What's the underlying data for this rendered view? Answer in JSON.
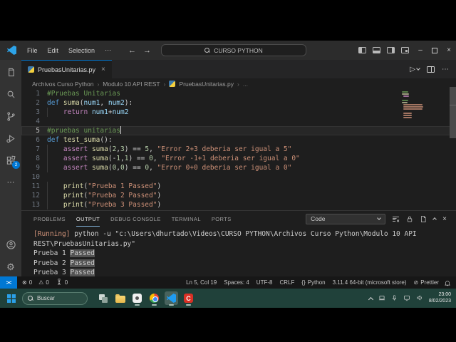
{
  "colors": {
    "accent": "#0078d4",
    "editor_bg": "#1e1e1e",
    "taskbar_bg": "#20413a",
    "remote_bg": "#0078d4"
  },
  "glyphs": {
    "close": "×",
    "more": "⋯",
    "separator": "›",
    "back": "←",
    "forward": "→",
    "min": "–",
    "run": "▷",
    "error": "⊗",
    "warning": "⚠",
    "braces": "{}",
    "slash": "⊘",
    "remote": "><",
    "gear": "⚙"
  },
  "title_bar": {
    "menus": [
      "File",
      "Edit",
      "Selection",
      "⋯"
    ],
    "search_label": "CURSO PYTHON"
  },
  "activity_bar": {
    "extensions_badge": "2"
  },
  "editor_tabs": {
    "active_tab": {
      "label": "PruebasUnitarias.py"
    }
  },
  "breadcrumb": {
    "items": [
      "Archivos Curso Python",
      "Modulo 10 API REST",
      "PruebasUnitarias.py",
      "..."
    ]
  },
  "editor": {
    "lines": [
      {
        "n": "1",
        "tokens": [
          {
            "t": "#Pruebas Unitarias",
            "c": "cm"
          }
        ]
      },
      {
        "n": "2",
        "tokens": [
          {
            "t": "def ",
            "c": "kw"
          },
          {
            "t": "suma",
            "c": "fn"
          },
          {
            "t": "(",
            "c": "pn"
          },
          {
            "t": "num1",
            "c": "var"
          },
          {
            "t": ", ",
            "c": "pn"
          },
          {
            "t": "num2",
            "c": "var"
          },
          {
            "t": "):",
            "c": "pn"
          }
        ]
      },
      {
        "n": "3",
        "ind": true,
        "tokens": [
          {
            "t": "    ",
            "c": "pn"
          },
          {
            "t": "return ",
            "c": "ctl"
          },
          {
            "t": "num1",
            "c": "var"
          },
          {
            "t": "+",
            "c": "pn"
          },
          {
            "t": "num2",
            "c": "var"
          }
        ]
      },
      {
        "n": "4",
        "tokens": []
      },
      {
        "n": "5",
        "cur": true,
        "cursor": true,
        "tokens": [
          {
            "t": "#pruebas unitarias",
            "c": "cm"
          }
        ]
      },
      {
        "n": "6",
        "tokens": [
          {
            "t": "def ",
            "c": "kw"
          },
          {
            "t": "test_suma",
            "c": "fn"
          },
          {
            "t": "():",
            "c": "pn"
          }
        ]
      },
      {
        "n": "7",
        "ind": true,
        "tokens": [
          {
            "t": "    ",
            "c": "pn"
          },
          {
            "t": "assert ",
            "c": "ctl"
          },
          {
            "t": "suma",
            "c": "fn"
          },
          {
            "t": "(",
            "c": "pn"
          },
          {
            "t": "2",
            "c": "num"
          },
          {
            "t": ",",
            "c": "pn"
          },
          {
            "t": "3",
            "c": "num"
          },
          {
            "t": ") ",
            "c": "pn"
          },
          {
            "t": "== ",
            "c": "pn"
          },
          {
            "t": "5",
            "c": "num"
          },
          {
            "t": ", ",
            "c": "pn"
          },
          {
            "t": "\"Error 2+3 deberia ser igual a 5\"",
            "c": "str"
          }
        ]
      },
      {
        "n": "8",
        "ind": true,
        "tokens": [
          {
            "t": "    ",
            "c": "pn"
          },
          {
            "t": "assert ",
            "c": "ctl"
          },
          {
            "t": "suma",
            "c": "fn"
          },
          {
            "t": "(",
            "c": "pn"
          },
          {
            "t": "-",
            "c": "pn"
          },
          {
            "t": "1",
            "c": "num"
          },
          {
            "t": ",",
            "c": "pn"
          },
          {
            "t": "1",
            "c": "num"
          },
          {
            "t": ") ",
            "c": "pn"
          },
          {
            "t": "== ",
            "c": "pn"
          },
          {
            "t": "0",
            "c": "num"
          },
          {
            "t": ", ",
            "c": "pn"
          },
          {
            "t": "\"Error -1+1 deberia ser igual a 0\"",
            "c": "str"
          }
        ]
      },
      {
        "n": "9",
        "ind": true,
        "tokens": [
          {
            "t": "    ",
            "c": "pn"
          },
          {
            "t": "assert ",
            "c": "ctl"
          },
          {
            "t": "suma",
            "c": "fn"
          },
          {
            "t": "(",
            "c": "pn"
          },
          {
            "t": "0",
            "c": "num"
          },
          {
            "t": ",",
            "c": "pn"
          },
          {
            "t": "0",
            "c": "num"
          },
          {
            "t": ") ",
            "c": "pn"
          },
          {
            "t": "== ",
            "c": "pn"
          },
          {
            "t": "0",
            "c": "num"
          },
          {
            "t": ", ",
            "c": "pn"
          },
          {
            "t": "\"Error 0+0 deberia ser igual a 0\"",
            "c": "str"
          }
        ]
      },
      {
        "n": "10",
        "tokens": []
      },
      {
        "n": "11",
        "ind": true,
        "tokens": [
          {
            "t": "    ",
            "c": "pn"
          },
          {
            "t": "print",
            "c": "fn"
          },
          {
            "t": "(",
            "c": "pn"
          },
          {
            "t": "\"Prueba 1 Passed\"",
            "c": "str"
          },
          {
            "t": ")",
            "c": "pn"
          }
        ]
      },
      {
        "n": "12",
        "ind": true,
        "tokens": [
          {
            "t": "    ",
            "c": "pn"
          },
          {
            "t": "print",
            "c": "fn"
          },
          {
            "t": "(",
            "c": "pn"
          },
          {
            "t": "\"Prueba 2 Passed\"",
            "c": "str"
          },
          {
            "t": ")",
            "c": "pn"
          }
        ]
      },
      {
        "n": "13",
        "ind": true,
        "tokens": [
          {
            "t": "    ",
            "c": "pn"
          },
          {
            "t": "print",
            "c": "fn"
          },
          {
            "t": "(",
            "c": "pn"
          },
          {
            "t": "\"Prueba 3 Passed\"",
            "c": "str"
          },
          {
            "t": ")",
            "c": "pn"
          }
        ]
      }
    ]
  },
  "panel": {
    "tabs": [
      {
        "label": "PROBLEMS"
      },
      {
        "label": "OUTPUT",
        "active": true
      },
      {
        "label": "DEBUG CONSOLE"
      },
      {
        "label": "TERMINAL"
      },
      {
        "label": "PORTS"
      }
    ],
    "channel_select": "Code",
    "output": [
      [
        {
          "t": "[Running] ",
          "c": "run"
        },
        {
          "t": "python -u \"c:\\Users\\dhurtado\\Videos\\CURSO PYTHON\\Archivos Curso Python\\Modulo 10 API",
          "c": "pl"
        }
      ],
      [
        {
          "t": "REST\\PruebasUnitarias.py\"",
          "c": "pl"
        }
      ],
      [
        {
          "t": "Prueba 1 ",
          "c": "pl"
        },
        {
          "t": "Passed",
          "c": "hl"
        }
      ],
      [
        {
          "t": "Prueba 2 ",
          "c": "pl"
        },
        {
          "t": "Passed",
          "c": "hl"
        }
      ],
      [
        {
          "t": "Prueba 3 ",
          "c": "pl"
        },
        {
          "t": "Passed",
          "c": "hl"
        }
      ]
    ]
  },
  "status_bar": {
    "left": [
      {
        "icon": "error",
        "label": "0"
      },
      {
        "icon": "warning",
        "label": "0"
      },
      {
        "icon": "tower",
        "label": "0"
      }
    ],
    "right": [
      {
        "label": "Ln 5, Col 19"
      },
      {
        "label": "Spaces: 4"
      },
      {
        "label": "UTF-8"
      },
      {
        "label": "CRLF"
      },
      {
        "icon": "braces",
        "label": "Python"
      },
      {
        "label": "3.11.4 64-bit (microsoft store)"
      },
      {
        "icon": "slash",
        "label": "Prettier"
      }
    ]
  },
  "taskbar": {
    "search_placeholder": "Buscar",
    "apps": [
      "task-view",
      "file-explorer",
      "recorder",
      "chrome",
      "vscode",
      "camtasia"
    ],
    "camtasia_glyph": "C",
    "clock": {
      "time": "23:00",
      "date": "8/02/2023"
    }
  }
}
